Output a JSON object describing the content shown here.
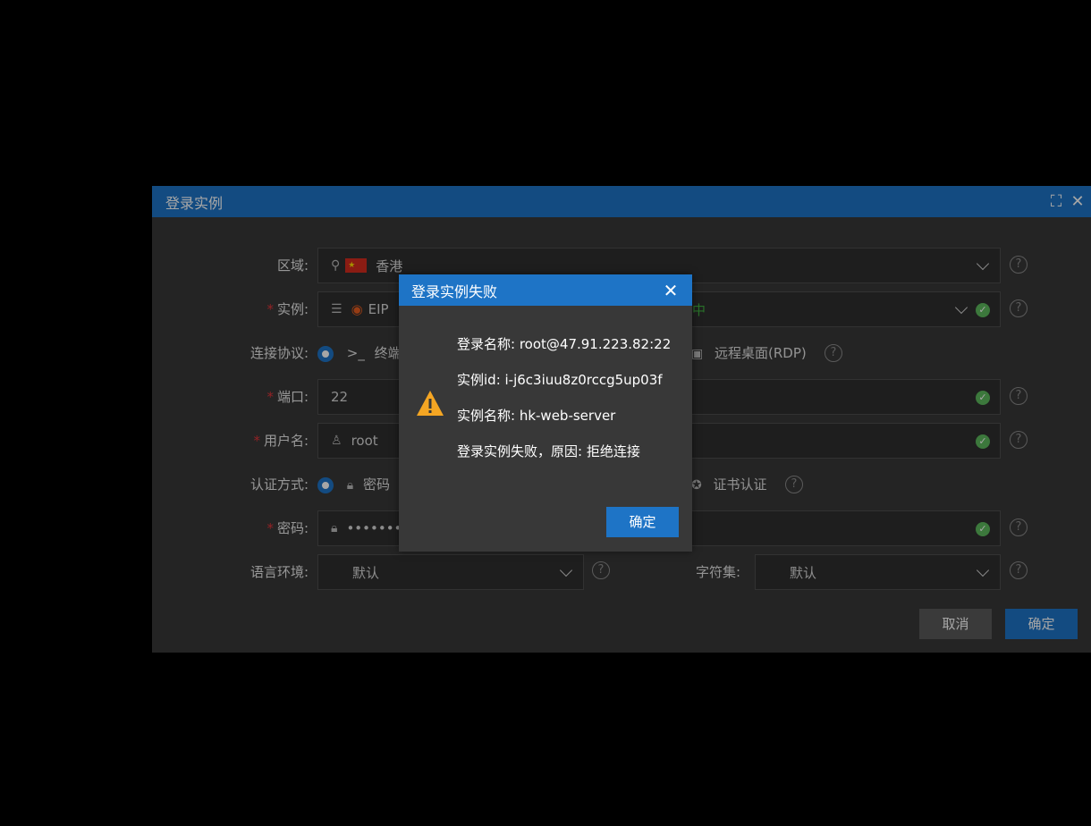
{
  "login_dialog": {
    "title": "登录实例",
    "fields": {
      "region": {
        "label": "区域:",
        "flag": "★",
        "value": "香港"
      },
      "instance": {
        "label": "实例:",
        "prefix": "EIP",
        "status": "中"
      },
      "protocol": {
        "label": "连接协议:",
        "terminal": "终端",
        "rdp": "远程桌面(RDP)"
      },
      "port": {
        "label": "端口:",
        "value": "22"
      },
      "username": {
        "label": "用户名:",
        "value": "root"
      },
      "auth": {
        "label": "认证方式:",
        "password": "密码",
        "cert": "证书认证"
      },
      "password": {
        "label": "密码:",
        "masked": "••••••••"
      },
      "language": {
        "label": "语言环境:",
        "value": "默认"
      },
      "charset": {
        "label": "字符集:",
        "value": "默认"
      }
    },
    "help": "?",
    "cancel_label": "取消",
    "confirm_label": "确定"
  },
  "error_dialog": {
    "title": "登录实例失败",
    "close": "✕",
    "lines": {
      "login_name": "登录名称: root@47.91.223.82:22",
      "instance_id": "实例id: i-j6c3iuu8z0rccg5up03f",
      "instance_name": "实例名称: hk-web-server",
      "reason": "登录实例失败，原因: 拒绝连接"
    },
    "confirm_label": "确定"
  },
  "colors": {
    "accent": "#1e74c6",
    "panel": "#383838",
    "success": "#5cb85c",
    "warning": "#f5a623",
    "required": "#e0353a"
  }
}
